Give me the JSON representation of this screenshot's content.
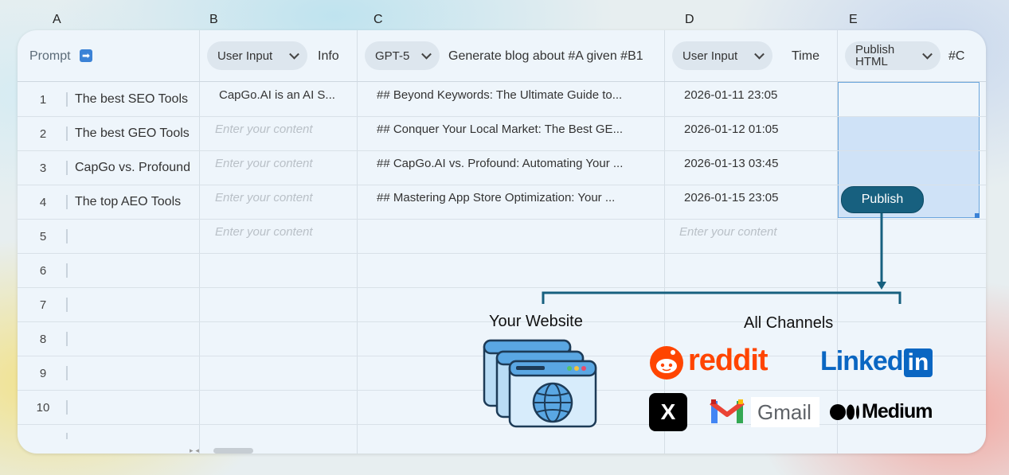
{
  "columns": {
    "a": "A",
    "b": "B",
    "c": "C",
    "d": "D",
    "e": "E"
  },
  "header": {
    "prompt_label": "Prompt",
    "prompt_icon": "arrow-right-icon",
    "b_pill": "User Input",
    "b_title": "Info",
    "c_pill": "GPT-5",
    "c_title": "Generate blog about #A given #B1",
    "d_pill": "User Input",
    "d_title": "Time",
    "e_pill_line1": "Publish",
    "e_pill_line2": "HTML",
    "e_title": "#C"
  },
  "rows": [
    {
      "num": "1",
      "prompt": "The best SEO Tools",
      "info": "CapGo.AI is an AI S...",
      "blog": "## Beyond Keywords: The Ultimate Guide to...",
      "time": "2026-01-11 23:05"
    },
    {
      "num": "2",
      "prompt": "The best GEO Tools",
      "info": "",
      "blog": "## Conquer Your Local Market: The Best GE...",
      "time": "2026-01-12 01:05"
    },
    {
      "num": "3",
      "prompt": "CapGo vs. Profound",
      "info": "",
      "blog": "## CapGo.AI vs. Profound: Automating Your ...",
      "time": "2026-01-13 03:45"
    },
    {
      "num": "4",
      "prompt": "The top AEO Tools",
      "info": "",
      "blog": "## Mastering App Store Optimization: Your ...",
      "time": "2026-01-15 23:05"
    },
    {
      "num": "5",
      "prompt": "",
      "info": "",
      "blog": "",
      "time": ""
    },
    {
      "num": "6"
    },
    {
      "num": "7"
    },
    {
      "num": "8"
    },
    {
      "num": "9"
    },
    {
      "num": "10"
    }
  ],
  "placeholder": "Enter your content",
  "publish_button": "Publish",
  "overlay": {
    "website_label": "Your Website",
    "channels_label": "All Channels",
    "reddit": "reddit",
    "linkedin_text": "Linked",
    "linkedin_box": "in",
    "x_label": "X",
    "gmail": "Gmail",
    "medium": "Medium"
  },
  "colors": {
    "accent": "#17607f",
    "selection": "#cfe2f7",
    "reddit": "#ff4500",
    "linkedin": "#0a66c2"
  }
}
